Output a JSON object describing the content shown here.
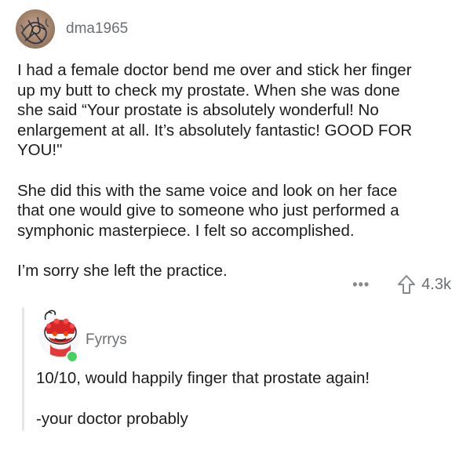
{
  "post": {
    "username": "dma1965",
    "paragraphs": [
      [
        "I had a female doctor bend me over and stick her finger",
        "up my butt to check my prostate. When she was done",
        "she said “Your prostate is absolutely wonderful! No",
        "enlargement  at all. It’s absolutely fantastic! GOOD FOR",
        "YOU!\""
      ],
      [
        "She did this with the same voice and look on her face",
        "that one would give to someone who just performed a",
        "symphonic masterpiece. I felt so accomplished."
      ],
      [
        "I’m sorry she left the practice."
      ]
    ],
    "more_label": "•••",
    "upvote_icon": "upvote-arrow-icon",
    "score": "4.3k"
  },
  "reply": {
    "username": "Fyrrys",
    "lines": [
      "10/10, would happily finger that prostate again!",
      "-your doctor probably"
    ],
    "online_color": "#46d160"
  }
}
